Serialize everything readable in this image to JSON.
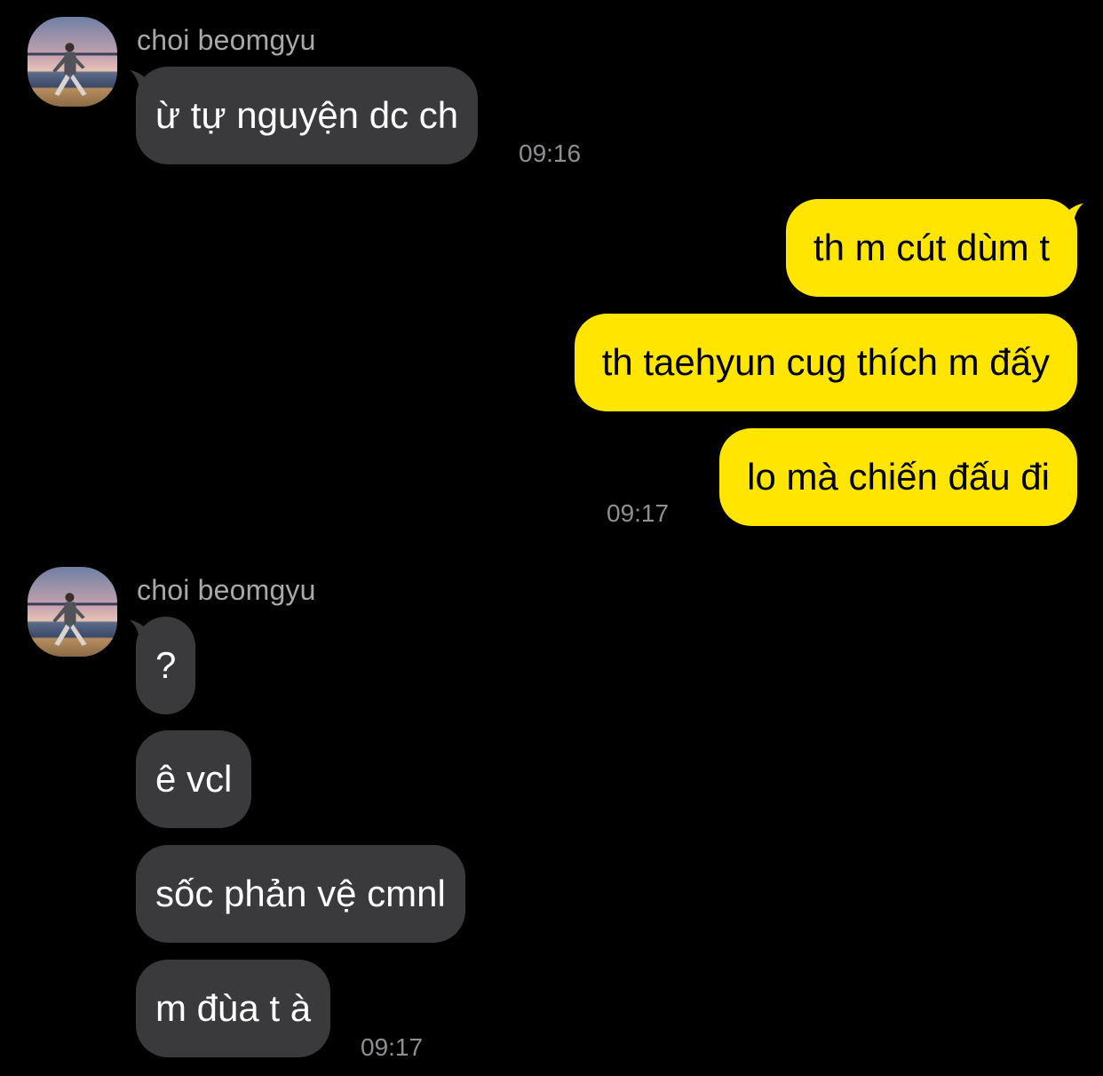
{
  "colors": {
    "background": "#000000",
    "incoming_bubble": "#3a3a3c",
    "outgoing_bubble": "#ffe500",
    "name_text": "#a8a8a8",
    "timestamp": "#8e8e93"
  },
  "groups": [
    {
      "sender": "choi beomgyu",
      "avatar_icon": "profile-photo",
      "messages": [
        "ừ tự nguyện dc ch"
      ],
      "time": "09:16"
    },
    {
      "sender": "me",
      "messages": [
        "th m cút dùm t",
        "th taehyun cug thích m đấy",
        "lo mà chiến đấu đi"
      ],
      "time": "09:17"
    },
    {
      "sender": "choi beomgyu",
      "avatar_icon": "profile-photo",
      "messages": [
        "?",
        "ê vcl",
        "sốc phản vệ cmnl",
        "m đùa t à"
      ],
      "time": "09:17"
    }
  ]
}
